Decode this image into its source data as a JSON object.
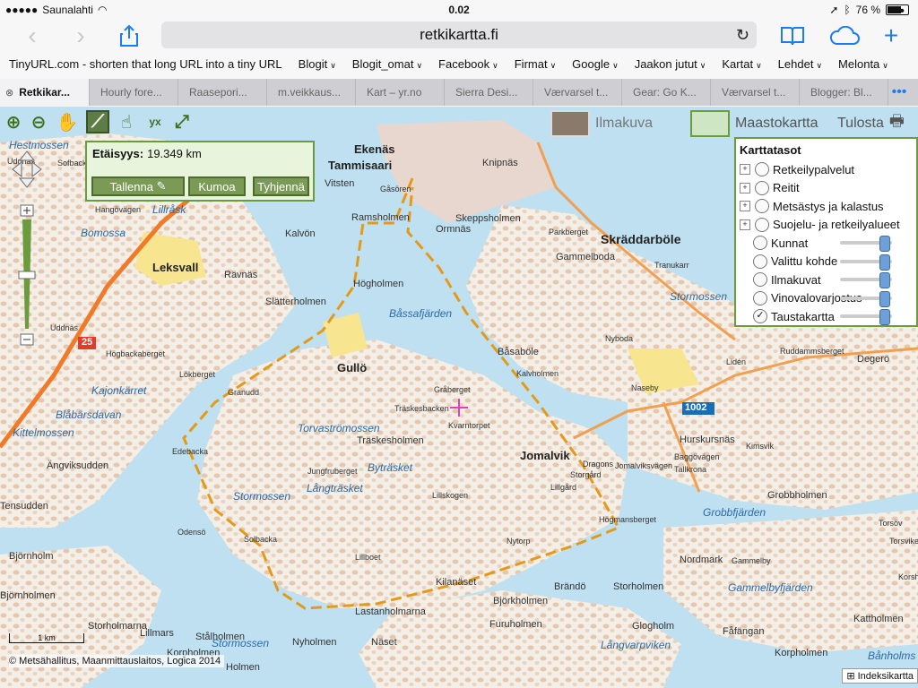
{
  "status_bar": {
    "carrier": "Saunalahti",
    "time": "0.02",
    "battery": "76 %",
    "battery_level": 0.76,
    "wifi_icon": "wifi-icon",
    "location_icon": "location-arrow-icon",
    "bluetooth_icon": "bluetooth-icon"
  },
  "nav": {
    "url": "retkikartta.fi"
  },
  "bookmarks": [
    {
      "label": "TinyURL.com - shorten that long URL into a tiny URL",
      "menu": false
    },
    {
      "label": "Blogit",
      "menu": true
    },
    {
      "label": "Blogit_omat",
      "menu": true
    },
    {
      "label": "Facebook",
      "menu": true
    },
    {
      "label": "Firmat",
      "menu": true
    },
    {
      "label": "Google",
      "menu": true
    },
    {
      "label": "Jaakon jutut",
      "menu": true
    },
    {
      "label": "Kartat",
      "menu": true
    },
    {
      "label": "Lehdet",
      "menu": true
    },
    {
      "label": "Melonta",
      "menu": true
    }
  ],
  "bookmarks_more": "•••",
  "tabs": [
    {
      "label": "Retkikar...",
      "active": true
    },
    {
      "label": "Hourly fore...",
      "active": false
    },
    {
      "label": "Raasepori...",
      "active": false
    },
    {
      "label": "m.veikkaus...",
      "active": false
    },
    {
      "label": "Kart – yr.no",
      "active": false
    },
    {
      "label": "Sierra Desi...",
      "active": false
    },
    {
      "label": "Værvarsel t...",
      "active": false
    },
    {
      "label": "Gear: Go K...",
      "active": false
    },
    {
      "label": "Værvarsel t...",
      "active": false
    },
    {
      "label": "Blogger: Bl...",
      "active": false
    }
  ],
  "tabs_more": "•••",
  "map_toolbar": {
    "aerial_label": "Ilmakuva",
    "terrain_label": "Maastokartta",
    "print_label": "Tulosta"
  },
  "distance": {
    "label": "Etäisyys:",
    "value": "19.349 km",
    "save": "Tallenna",
    "undo": "Kumoa",
    "clear": "Tyhjennä"
  },
  "layers": {
    "title": "Karttatasot",
    "items": [
      {
        "label": "Retkeilypalvelut",
        "expandable": true,
        "checked": false,
        "slider": null
      },
      {
        "label": "Reitit",
        "expandable": true,
        "checked": false,
        "slider": null
      },
      {
        "label": "Metsästys ja kalastus",
        "expandable": true,
        "checked": false,
        "slider": null
      },
      {
        "label": "Suojelu- ja retkeilyalueet",
        "expandable": true,
        "checked": false,
        "slider": null
      },
      {
        "label": "Kunnat",
        "expandable": false,
        "checked": false,
        "slider": 0.85
      },
      {
        "label": "Valittu kohde",
        "expandable": false,
        "checked": false,
        "slider": 0.85
      },
      {
        "label": "Ilmakuvat",
        "expandable": false,
        "checked": false,
        "slider": 0.85
      },
      {
        "label": "Vinovalovarjostus",
        "expandable": false,
        "checked": false,
        "slider": 0.85
      },
      {
        "label": "Taustakartta",
        "expandable": false,
        "checked": true,
        "slider": 0.85
      }
    ]
  },
  "map_labels": [
    {
      "t": "Ekenäs",
      "c": "b"
    },
    {
      "t": "Tammisaari",
      "c": "b"
    },
    {
      "t": "Skräddarböle",
      "c": "big"
    },
    {
      "t": "Leksvall",
      "c": "b"
    },
    {
      "t": "Jomalvik",
      "c": "b"
    },
    {
      "t": "Gullö",
      "c": "b"
    },
    {
      "t": "Knipnäs",
      "c": ""
    },
    {
      "t": "Storholmen",
      "c": ""
    },
    {
      "t": "Vitsten",
      "c": ""
    },
    {
      "t": "Gåsören",
      "c": "s"
    },
    {
      "t": "Skeppsholmen",
      "c": ""
    },
    {
      "t": "Ormnäs",
      "c": ""
    },
    {
      "t": "Ramsholmen",
      "c": ""
    },
    {
      "t": "Kalvön",
      "c": ""
    },
    {
      "t": "Högholmen",
      "c": ""
    },
    {
      "t": "Gammelboda",
      "c": ""
    },
    {
      "t": "Parkberget",
      "c": "s"
    },
    {
      "t": "Tranukarr",
      "c": "s"
    },
    {
      "t": "Rävnäs",
      "c": ""
    },
    {
      "t": "Slätterholmen",
      "c": ""
    },
    {
      "t": "Båssafjärden",
      "c": "w"
    },
    {
      "t": "Stormossen",
      "c": "w"
    },
    {
      "t": "Båsaböle",
      "c": ""
    },
    {
      "t": "Nyboda",
      "c": "s"
    },
    {
      "t": "Kalvholmen",
      "c": "s"
    },
    {
      "t": "Högbackaberget",
      "c": "s"
    },
    {
      "t": "Lökberget",
      "c": "s"
    },
    {
      "t": "Granudd",
      "c": "s"
    },
    {
      "t": "Gråberget",
      "c": "s"
    },
    {
      "t": "Träskesbacken",
      "c": "s"
    },
    {
      "t": "Kvarntorpet",
      "c": "s"
    },
    {
      "t": "Träskesholmen",
      "c": ""
    },
    {
      "t": "Kajonkärret",
      "c": "w"
    },
    {
      "t": "Blåbärsdavan",
      "c": "w"
    },
    {
      "t": "Kittelmossen",
      "c": "w"
    },
    {
      "t": "Ängviksudden",
      "c": ""
    },
    {
      "t": "Edebacka",
      "c": "s"
    },
    {
      "t": "Torvaströmossen",
      "c": "w"
    },
    {
      "t": "Byträsket",
      "c": "w"
    },
    {
      "t": "Jungfruberget",
      "c": "s"
    },
    {
      "t": "Långträsket",
      "c": "w"
    },
    {
      "t": "Lillskogen",
      "c": "s"
    },
    {
      "t": "Stormossen",
      "c": "w"
    },
    {
      "t": "Odensö",
      "c": "s"
    },
    {
      "t": "Solbacka",
      "c": "s"
    },
    {
      "t": "Lillboet",
      "c": "s"
    },
    {
      "t": "Nytorp",
      "c": "s"
    },
    {
      "t": "Lillgård",
      "c": "s"
    },
    {
      "t": "Storgård",
      "c": "s"
    },
    {
      "t": "Dragons",
      "c": "s"
    },
    {
      "t": "Jomalviksvägen",
      "c": "s"
    },
    {
      "t": "Högmansberget",
      "c": "s"
    },
    {
      "t": "Naseby",
      "c": "s"
    },
    {
      "t": "Hurskursnäs",
      "c": ""
    },
    {
      "t": "Tallkrona",
      "c": "s"
    },
    {
      "t": "Baggövägen",
      "c": "s"
    },
    {
      "t": "Grobbholmen",
      "c": ""
    },
    {
      "t": "Grobbfjärden",
      "c": "w"
    },
    {
      "t": "Kimsvik",
      "c": "s"
    },
    {
      "t": "Degerö",
      "c": ""
    },
    {
      "t": "Ruddammsberget",
      "c": "s"
    },
    {
      "t": "Lidén",
      "c": "s"
    },
    {
      "t": "Björnholm",
      "c": ""
    },
    {
      "t": "Björnholmen",
      "c": ""
    },
    {
      "t": "Stormossen",
      "c": "w"
    },
    {
      "t": "Hangövägen",
      "c": "s"
    },
    {
      "t": "Lillråsk",
      "c": "w"
    },
    {
      "t": "Bomossa",
      "c": "w"
    },
    {
      "t": "Hestmossen",
      "c": "w"
    },
    {
      "t": "Uddnäs",
      "c": "s"
    },
    {
      "t": "Kilanäset",
      "c": ""
    },
    {
      "t": "Lastanholmarna",
      "c": ""
    },
    {
      "t": "Björkholmen",
      "c": ""
    },
    {
      "t": "Brändö",
      "c": ""
    },
    {
      "t": "Storholmen",
      "c": ""
    },
    {
      "t": "Furuholmen",
      "c": ""
    },
    {
      "t": "Storholmarna",
      "c": ""
    },
    {
      "t": "Lillmars",
      "c": ""
    },
    {
      "t": "Näset",
      "c": ""
    },
    {
      "t": "Korpholmen",
      "c": ""
    },
    {
      "t": "Holmen",
      "c": ""
    },
    {
      "t": "Stålholmen",
      "c": ""
    },
    {
      "t": "Nyholmen",
      "c": ""
    },
    {
      "t": "Glogholm",
      "c": ""
    },
    {
      "t": "Långvarpviken",
      "c": "w"
    },
    {
      "t": "Fåfängan",
      "c": ""
    },
    {
      "t": "Nordmark",
      "c": ""
    },
    {
      "t": "Gammelbyfjärden",
      "c": "w"
    },
    {
      "t": "Kattholmen",
      "c": ""
    },
    {
      "t": "Korpholmen",
      "c": ""
    },
    {
      "t": "Bånholms",
      "c": "w"
    },
    {
      "t": "Torsöv",
      "c": "s"
    },
    {
      "t": "Torsviken",
      "c": "s"
    },
    {
      "t": "Korsh",
      "c": "s"
    },
    {
      "t": "Gammelby",
      "c": "s"
    },
    {
      "t": "Tensudden",
      "c": ""
    },
    {
      "t": "Sofbacka",
      "c": "s"
    },
    {
      "t": "Uddnäs",
      "c": "s"
    }
  ],
  "road_labels": [
    "25",
    "1002"
  ],
  "scale_label": "1 km",
  "copyright": "© Metsähallitus, Maanmittauslaitos, Logica 2014",
  "index_map": "Indeksikartta",
  "colors": {
    "water": "#bfe0f0",
    "land": "#f3eee6",
    "forest_dots": "#e8c9b0",
    "road_orange": "#f07a28",
    "route_dash": "#e39a1a",
    "panel_green": "#6c9b3d",
    "accent_blue": "#1a7cf5"
  }
}
